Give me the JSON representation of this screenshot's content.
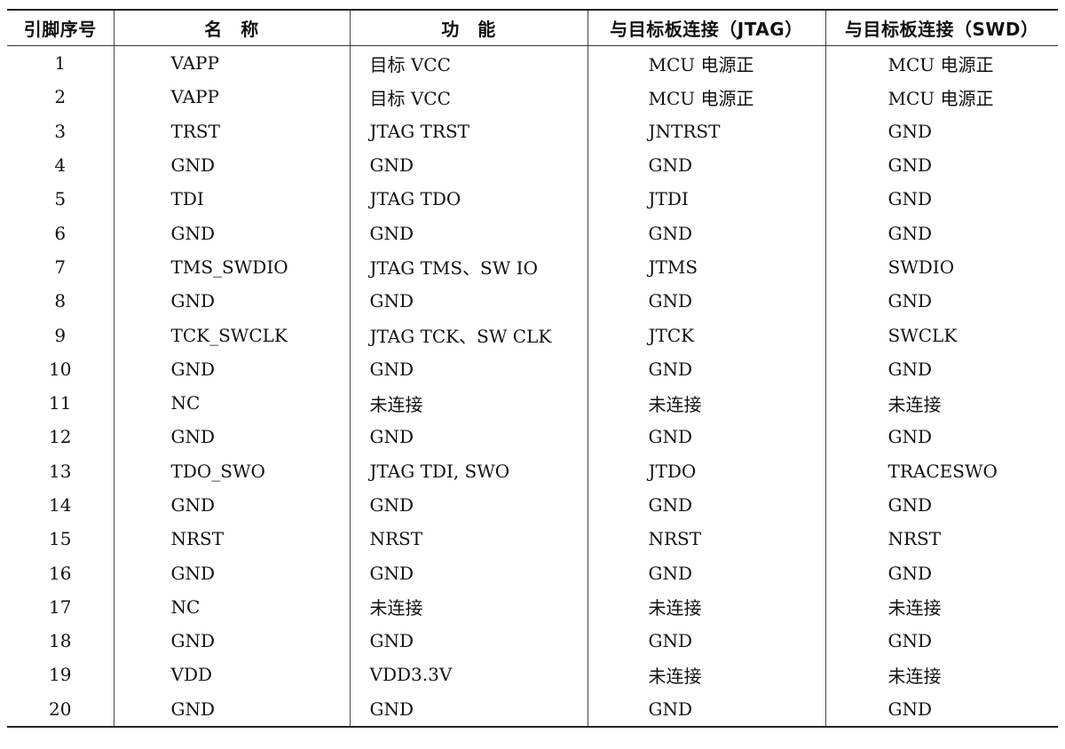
{
  "table": {
    "headers": {
      "pin": "引脚序号",
      "name": "名　称",
      "function": "功　能",
      "jtag": "与目标板连接（JTAG）",
      "swd": "与目标板连接（SWD）"
    },
    "rows": [
      {
        "pin": "1",
        "name": "VAPP",
        "function": "目标 VCC",
        "jtag": "MCU 电源正",
        "swd": "MCU 电源正"
      },
      {
        "pin": "2",
        "name": "VAPP",
        "function": "目标 VCC",
        "jtag": "MCU 电源正",
        "swd": "MCU 电源正"
      },
      {
        "pin": "3",
        "name": "TRST",
        "function": "JTAG TRST",
        "jtag": "JNTRST",
        "swd": "GND"
      },
      {
        "pin": "4",
        "name": "GND",
        "function": "GND",
        "jtag": "GND",
        "swd": "GND"
      },
      {
        "pin": "5",
        "name": "TDI",
        "function": "JTAG TDO",
        "jtag": "JTDI",
        "swd": "GND"
      },
      {
        "pin": "6",
        "name": "GND",
        "function": "GND",
        "jtag": "GND",
        "swd": "GND"
      },
      {
        "pin": "7",
        "name": "TMS_SWDIO",
        "function": "JTAG TMS、SW IO",
        "jtag": "JTMS",
        "swd": "SWDIO"
      },
      {
        "pin": "8",
        "name": "GND",
        "function": "GND",
        "jtag": "GND",
        "swd": "GND"
      },
      {
        "pin": "9",
        "name": "TCK_SWCLK",
        "function": "JTAG TCK、SW CLK",
        "jtag": "JTCK",
        "swd": "SWCLK"
      },
      {
        "pin": "10",
        "name": "GND",
        "function": "GND",
        "jtag": "GND",
        "swd": "GND"
      },
      {
        "pin": "11",
        "name": "NC",
        "function": "未连接",
        "jtag": "未连接",
        "swd": "未连接"
      },
      {
        "pin": "12",
        "name": "GND",
        "function": "GND",
        "jtag": "GND",
        "swd": "GND"
      },
      {
        "pin": "13",
        "name": "TDO_SWO",
        "function": "JTAG TDI, SWO",
        "jtag": "JTDO",
        "swd": "TRACESWO"
      },
      {
        "pin": "14",
        "name": "GND",
        "function": "GND",
        "jtag": "GND",
        "swd": "GND"
      },
      {
        "pin": "15",
        "name": "NRST",
        "function": "NRST",
        "jtag": "NRST",
        "swd": "NRST"
      },
      {
        "pin": "16",
        "name": "GND",
        "function": "GND",
        "jtag": "GND",
        "swd": "GND"
      },
      {
        "pin": "17",
        "name": "NC",
        "function": "未连接",
        "jtag": "未连接",
        "swd": "未连接"
      },
      {
        "pin": "18",
        "name": "GND",
        "function": "GND",
        "jtag": "GND",
        "swd": "GND"
      },
      {
        "pin": "19",
        "name": "VDD",
        "function": "VDD3.3V",
        "jtag": "未连接",
        "swd": "未连接"
      },
      {
        "pin": "20",
        "name": "GND",
        "function": "GND",
        "jtag": "GND",
        "swd": "GND"
      }
    ]
  }
}
